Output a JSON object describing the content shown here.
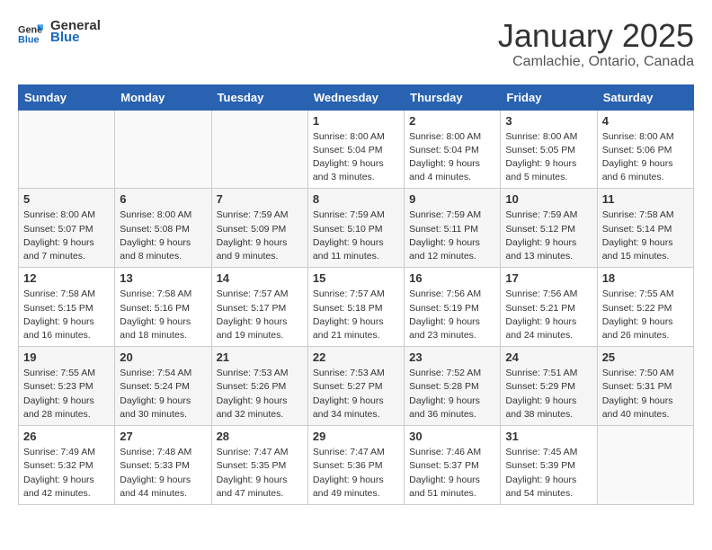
{
  "header": {
    "logo_line1": "General",
    "logo_line2": "Blue",
    "month": "January 2025",
    "location": "Camlachie, Ontario, Canada"
  },
  "weekdays": [
    "Sunday",
    "Monday",
    "Tuesday",
    "Wednesday",
    "Thursday",
    "Friday",
    "Saturday"
  ],
  "weeks": [
    [
      {
        "day": "",
        "info": ""
      },
      {
        "day": "",
        "info": ""
      },
      {
        "day": "",
        "info": ""
      },
      {
        "day": "1",
        "info": "Sunrise: 8:00 AM\nSunset: 5:04 PM\nDaylight: 9 hours\nand 3 minutes."
      },
      {
        "day": "2",
        "info": "Sunrise: 8:00 AM\nSunset: 5:04 PM\nDaylight: 9 hours\nand 4 minutes."
      },
      {
        "day": "3",
        "info": "Sunrise: 8:00 AM\nSunset: 5:05 PM\nDaylight: 9 hours\nand 5 minutes."
      },
      {
        "day": "4",
        "info": "Sunrise: 8:00 AM\nSunset: 5:06 PM\nDaylight: 9 hours\nand 6 minutes."
      }
    ],
    [
      {
        "day": "5",
        "info": "Sunrise: 8:00 AM\nSunset: 5:07 PM\nDaylight: 9 hours\nand 7 minutes."
      },
      {
        "day": "6",
        "info": "Sunrise: 8:00 AM\nSunset: 5:08 PM\nDaylight: 9 hours\nand 8 minutes."
      },
      {
        "day": "7",
        "info": "Sunrise: 7:59 AM\nSunset: 5:09 PM\nDaylight: 9 hours\nand 9 minutes."
      },
      {
        "day": "8",
        "info": "Sunrise: 7:59 AM\nSunset: 5:10 PM\nDaylight: 9 hours\nand 11 minutes."
      },
      {
        "day": "9",
        "info": "Sunrise: 7:59 AM\nSunset: 5:11 PM\nDaylight: 9 hours\nand 12 minutes."
      },
      {
        "day": "10",
        "info": "Sunrise: 7:59 AM\nSunset: 5:12 PM\nDaylight: 9 hours\nand 13 minutes."
      },
      {
        "day": "11",
        "info": "Sunrise: 7:58 AM\nSunset: 5:14 PM\nDaylight: 9 hours\nand 15 minutes."
      }
    ],
    [
      {
        "day": "12",
        "info": "Sunrise: 7:58 AM\nSunset: 5:15 PM\nDaylight: 9 hours\nand 16 minutes."
      },
      {
        "day": "13",
        "info": "Sunrise: 7:58 AM\nSunset: 5:16 PM\nDaylight: 9 hours\nand 18 minutes."
      },
      {
        "day": "14",
        "info": "Sunrise: 7:57 AM\nSunset: 5:17 PM\nDaylight: 9 hours\nand 19 minutes."
      },
      {
        "day": "15",
        "info": "Sunrise: 7:57 AM\nSunset: 5:18 PM\nDaylight: 9 hours\nand 21 minutes."
      },
      {
        "day": "16",
        "info": "Sunrise: 7:56 AM\nSunset: 5:19 PM\nDaylight: 9 hours\nand 23 minutes."
      },
      {
        "day": "17",
        "info": "Sunrise: 7:56 AM\nSunset: 5:21 PM\nDaylight: 9 hours\nand 24 minutes."
      },
      {
        "day": "18",
        "info": "Sunrise: 7:55 AM\nSunset: 5:22 PM\nDaylight: 9 hours\nand 26 minutes."
      }
    ],
    [
      {
        "day": "19",
        "info": "Sunrise: 7:55 AM\nSunset: 5:23 PM\nDaylight: 9 hours\nand 28 minutes."
      },
      {
        "day": "20",
        "info": "Sunrise: 7:54 AM\nSunset: 5:24 PM\nDaylight: 9 hours\nand 30 minutes."
      },
      {
        "day": "21",
        "info": "Sunrise: 7:53 AM\nSunset: 5:26 PM\nDaylight: 9 hours\nand 32 minutes."
      },
      {
        "day": "22",
        "info": "Sunrise: 7:53 AM\nSunset: 5:27 PM\nDaylight: 9 hours\nand 34 minutes."
      },
      {
        "day": "23",
        "info": "Sunrise: 7:52 AM\nSunset: 5:28 PM\nDaylight: 9 hours\nand 36 minutes."
      },
      {
        "day": "24",
        "info": "Sunrise: 7:51 AM\nSunset: 5:29 PM\nDaylight: 9 hours\nand 38 minutes."
      },
      {
        "day": "25",
        "info": "Sunrise: 7:50 AM\nSunset: 5:31 PM\nDaylight: 9 hours\nand 40 minutes."
      }
    ],
    [
      {
        "day": "26",
        "info": "Sunrise: 7:49 AM\nSunset: 5:32 PM\nDaylight: 9 hours\nand 42 minutes."
      },
      {
        "day": "27",
        "info": "Sunrise: 7:48 AM\nSunset: 5:33 PM\nDaylight: 9 hours\nand 44 minutes."
      },
      {
        "day": "28",
        "info": "Sunrise: 7:47 AM\nSunset: 5:35 PM\nDaylight: 9 hours\nand 47 minutes."
      },
      {
        "day": "29",
        "info": "Sunrise: 7:47 AM\nSunset: 5:36 PM\nDaylight: 9 hours\nand 49 minutes."
      },
      {
        "day": "30",
        "info": "Sunrise: 7:46 AM\nSunset: 5:37 PM\nDaylight: 9 hours\nand 51 minutes."
      },
      {
        "day": "31",
        "info": "Sunrise: 7:45 AM\nSunset: 5:39 PM\nDaylight: 9 hours\nand 54 minutes."
      },
      {
        "day": "",
        "info": ""
      }
    ]
  ]
}
